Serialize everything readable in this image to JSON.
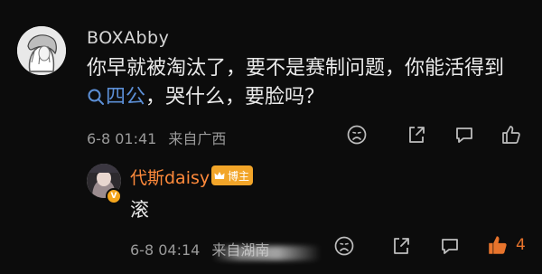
{
  "comment": {
    "username": "BOXAbby",
    "text_line1": "你早就被淘汰了，要不是赛制问题，你能活得到",
    "topic_label": "四公",
    "text_line2_rest": "，哭什么，要脸吗？",
    "timestamp": "6-8 01:41",
    "location": "来自广西",
    "icons": [
      "sad-face-icon",
      "share-icon",
      "comment-icon",
      "like-icon"
    ]
  },
  "reply": {
    "username": "代斯daisy",
    "badge_label": "博主",
    "text": "滚",
    "timestamp": "6-8 04:14",
    "location": "来自湖南",
    "like_count": "4",
    "colors": {
      "username": "#ff8a3b",
      "badge": "#f2a529",
      "like": "#e8742c"
    }
  }
}
